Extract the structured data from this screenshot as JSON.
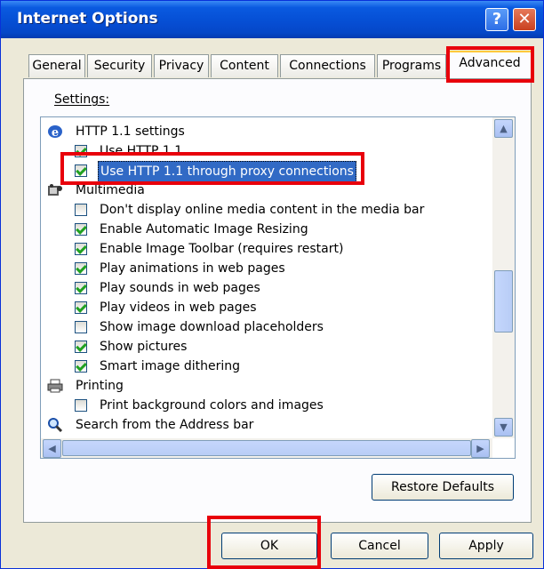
{
  "window": {
    "title": "Internet Options",
    "help_button": "?",
    "close_button": "✕"
  },
  "tabs": [
    {
      "label": "General"
    },
    {
      "label": "Security"
    },
    {
      "label": "Privacy"
    },
    {
      "label": "Content"
    },
    {
      "label": "Connections"
    },
    {
      "label": "Programs"
    },
    {
      "label": "Advanced",
      "active": true
    }
  ],
  "settings": {
    "label": "Settings:",
    "categories": {
      "http": "HTTP 1.1 settings",
      "multimedia": "Multimedia",
      "printing": "Printing",
      "search": "Search from the Address bar"
    },
    "items": {
      "use_http11": {
        "label": "Use HTTP 1.1",
        "checked": true
      },
      "use_http11_proxy": {
        "label": "Use HTTP 1.1 through proxy connections",
        "checked": true
      },
      "dont_display_media": {
        "label": "Don't display online media content in the media bar",
        "checked": false
      },
      "auto_image_resize": {
        "label": "Enable Automatic Image Resizing",
        "checked": true
      },
      "image_toolbar": {
        "label": "Enable Image Toolbar (requires restart)",
        "checked": true
      },
      "play_animations": {
        "label": "Play animations in web pages",
        "checked": true
      },
      "play_sounds": {
        "label": "Play sounds in web pages",
        "checked": true
      },
      "play_videos": {
        "label": "Play videos in web pages",
        "checked": true
      },
      "download_placeholders": {
        "label": "Show image download placeholders",
        "checked": false
      },
      "show_pictures": {
        "label": "Show pictures",
        "checked": true
      },
      "smart_dithering": {
        "label": "Smart image dithering",
        "checked": true
      },
      "print_background": {
        "label": "Print background colors and images",
        "checked": false
      }
    }
  },
  "buttons": {
    "restore_defaults": "Restore Defaults",
    "ok": "OK",
    "cancel": "Cancel",
    "apply": "Apply"
  },
  "colors": {
    "highlight": "#e8000b",
    "titlebar": "#0650d6",
    "selection": "#316ac5",
    "check": "#21a121"
  }
}
